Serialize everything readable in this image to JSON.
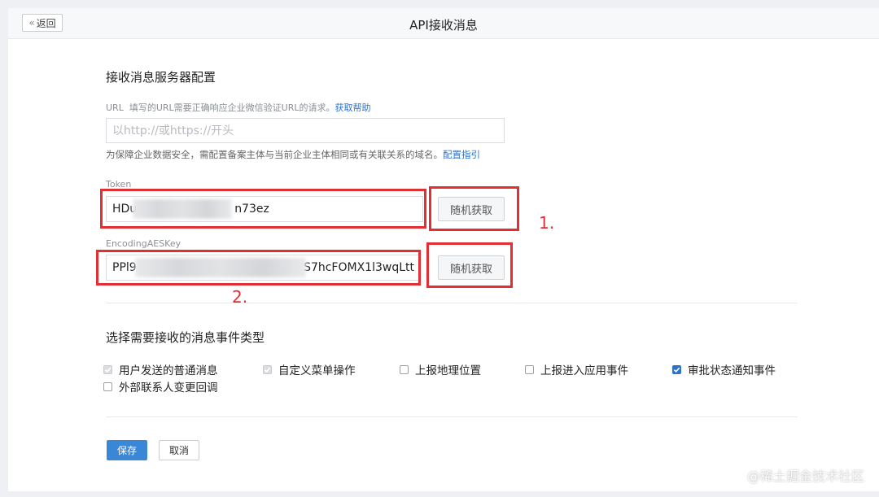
{
  "header": {
    "back_label": "返回",
    "title": "API接收消息"
  },
  "server_config": {
    "section_title": "接收消息服务器配置",
    "url_label": "URL",
    "url_desc": "填写的URL需要正确响应企业微信验证URL的请求。",
    "url_help_link": "获取帮助",
    "url_placeholder": "以http://或https://开头",
    "url_value": "",
    "hint_text": "为保障企业数据安全，需配置备案主体与当前企业主体相同或有关联关系的域名。",
    "hint_link": "配置指引",
    "token_label": "Token",
    "token_value_start": "HDu",
    "token_value_end": "n73ez",
    "token_random_button": "随机获取",
    "aes_label": "EncodingAESKey",
    "aes_value_start": "PPl9",
    "aes_value_end": "S7hcFOMX1l3wqLtt",
    "aes_random_button": "随机获取"
  },
  "annotations": {
    "marker_1": "1.",
    "marker_2": "2.",
    "color": "#e12f34"
  },
  "events": {
    "section_title": "选择需要接收的消息事件类型",
    "items": [
      {
        "label": "用户发送的普通消息",
        "checked": true,
        "disabled": true
      },
      {
        "label": "自定义菜单操作",
        "checked": true,
        "disabled": true
      },
      {
        "label": "上报地理位置",
        "checked": false,
        "disabled": false
      },
      {
        "label": "上报进入应用事件",
        "checked": false,
        "disabled": false
      },
      {
        "label": "审批状态通知事件",
        "checked": true,
        "disabled": false
      },
      {
        "label": "外部联系人变更回调",
        "checked": false,
        "disabled": false
      }
    ]
  },
  "actions": {
    "save_label": "保存",
    "cancel_label": "取消"
  },
  "watermark": "@稀土掘金技术社区",
  "colors": {
    "accent": "#3a87d8",
    "link": "#2f73c6",
    "checkbox_checked": "#2f73c6"
  }
}
